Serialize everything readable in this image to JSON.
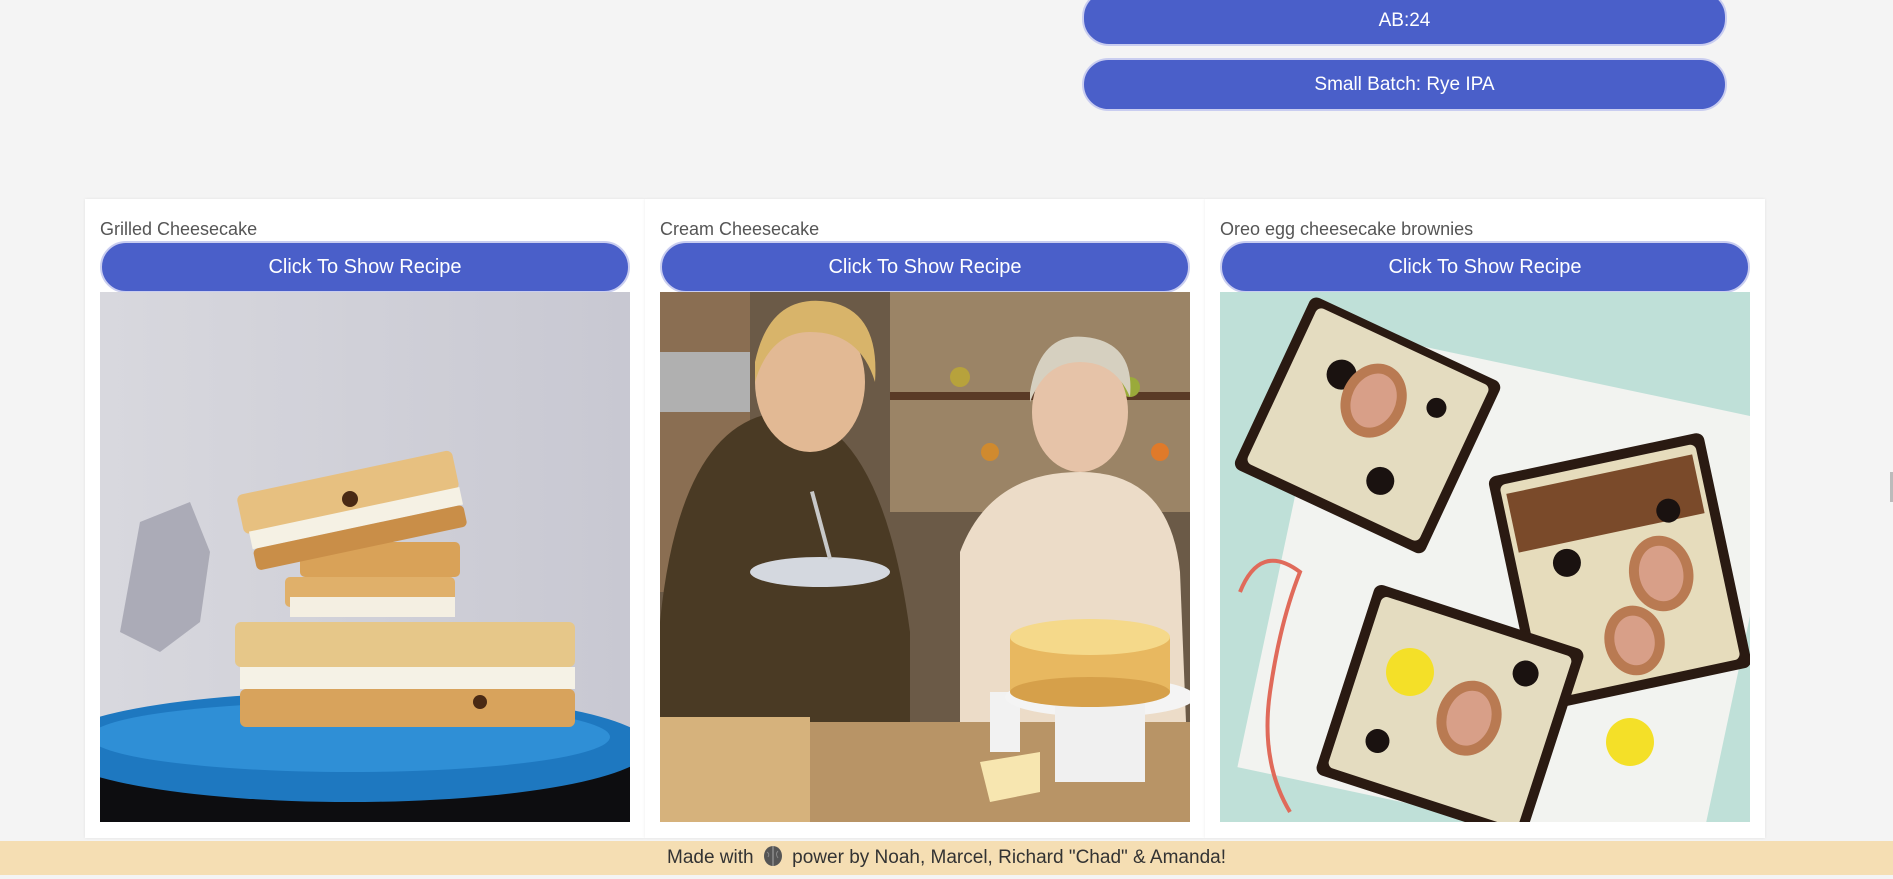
{
  "top_buttons": {
    "ab_label": "AB:24",
    "small_batch_label": "Small Batch: Rye IPA"
  },
  "cards": [
    {
      "title": "Grilled Cheesecake",
      "button_label": "Click To Show Recipe",
      "image": "grilled-cheesecake-photo"
    },
    {
      "title": "Cream Cheesecake",
      "button_label": "Click To Show Recipe",
      "image": "cream-cheesecake-photo"
    },
    {
      "title": "Oreo egg cheesecake brownies",
      "button_label": "Click To Show Recipe",
      "image": "oreo-egg-cheesecake-brownies-photo"
    }
  ],
  "footer": {
    "prefix": "Made with",
    "icon": "brain-icon",
    "suffix": "power by Noah, Marcel, Richard \"Chad\" & Amanda!"
  },
  "colors": {
    "button_blue": "#4a5fc9",
    "footer_bg": "#f5deb3",
    "page_bg": "#f4f4f4"
  }
}
